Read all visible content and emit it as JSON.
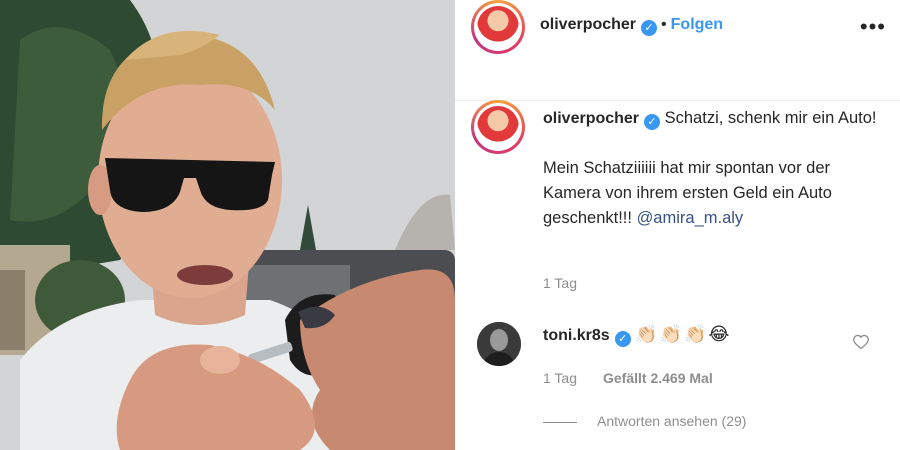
{
  "post": {
    "author": "oliverpocher",
    "follow_label": "Folgen",
    "separator": "•",
    "more_label": "•••"
  },
  "caption": {
    "username": "oliverpocher",
    "line1": "Schatzi, schenk mir ein Auto!",
    "line2": "Mein Schatziiiiii hat mir spontan vor der Kamera von ihrem ersten Geld ein Auto geschenkt!!! ",
    "mention": "@amira_m.aly",
    "time": "1 Tag"
  },
  "comment": {
    "username": "toni.kr8s",
    "emojis": "👏🏻👏🏻👏🏻😂",
    "time": "1 Tag",
    "likes": "Gefällt 2.469 Mal",
    "replies": "Antworten ansehen (29)"
  },
  "icons": {
    "verified": "verified-badge-icon",
    "heart": "heart-icon",
    "more": "more-options-icon"
  },
  "colors": {
    "link_blue": "#3897f0",
    "verified_blue": "#3897f0",
    "muted_text": "#8e8e8e"
  }
}
